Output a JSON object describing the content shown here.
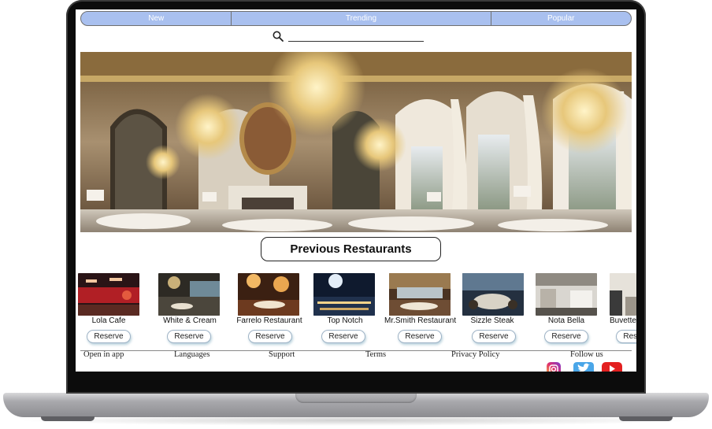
{
  "nav": {
    "tabs": [
      {
        "label": "New"
      },
      {
        "label": "Trending"
      },
      {
        "label": "Popular"
      }
    ],
    "accent": "#a9c0ef"
  },
  "search": {
    "value": "",
    "placeholder": ""
  },
  "hero": {
    "image": "ornate-restaurant-dining-room"
  },
  "section": {
    "title": "Previous Restaurants"
  },
  "restaurants": [
    {
      "name": "Lola Cafe",
      "reserve": "Reserve"
    },
    {
      "name": "White & Cream",
      "reserve": "Reserve"
    },
    {
      "name": "Farrelo Restaurant",
      "reserve": "Reserve"
    },
    {
      "name": "Top Notch",
      "reserve": "Reserve"
    },
    {
      "name": "Mr.Smith Restaurant",
      "reserve": "Reserve"
    },
    {
      "name": "Sizzle Steak",
      "reserve": "Reserve"
    },
    {
      "name": "Nota Bella",
      "reserve": "Reserve"
    },
    {
      "name": "Buvette",
      "reserve": "Reserve"
    }
  ],
  "footer": {
    "links": [
      "Open in app",
      "Languages",
      "Support",
      "Terms",
      "Privacy Policy"
    ],
    "follow_label": "Follow us",
    "social": [
      "instagram-icon",
      "twitter-icon",
      "youtube-icon"
    ]
  }
}
